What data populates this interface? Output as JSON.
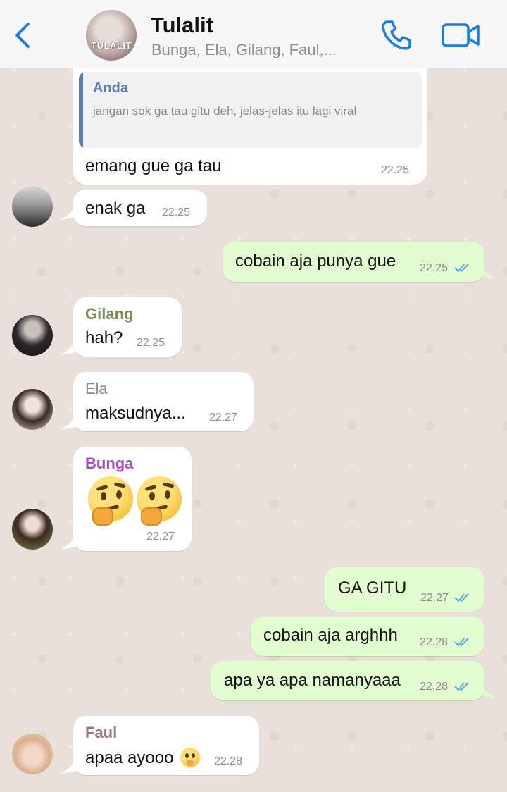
{
  "header": {
    "back_icon": "chevron-left-icon",
    "group_name": "Tulalit",
    "members": "Bunga, Ela, Gilang, Faul,...",
    "avatar_label": "TULALIT",
    "call_icon": "phone-icon",
    "video_icon": "video-camera-icon",
    "accent_color": "#1a7cf5"
  },
  "messages": {
    "m1": {
      "quote_author": "Anda",
      "quote_text": "jangan sok ga tau gitu deh, jelas-jelas itu lagi viral",
      "text": "emang gue ga tau",
      "time": "22.25"
    },
    "m2": {
      "text": "enak ga",
      "time": "22.25"
    },
    "m3": {
      "text": "cobain aja punya gue",
      "time": "22.25"
    },
    "m4": {
      "sender": "Gilang",
      "text": "hah?",
      "time": "22.25"
    },
    "m5": {
      "sender": "Ela",
      "text": "maksudnya...",
      "time": "22.27"
    },
    "m6": {
      "sender": "Bunga",
      "text": "🤔🤔",
      "time": "22.27"
    },
    "m7": {
      "text": "GA GITU",
      "time": "22.27"
    },
    "m8": {
      "text": "cobain aja arghhh",
      "time": "22.28"
    },
    "m9": {
      "text": "apa ya apa namanyaaa",
      "time": "22.28"
    },
    "m10": {
      "sender": "Faul",
      "text": "apaa ayooo",
      "time": "22.28"
    }
  },
  "colors": {
    "gilang": "#7a8f58",
    "ela": "#8a8a8a",
    "bunga": "#a64fbf",
    "faul": "#9a7d7d",
    "outgoing_bubble": "#e2fdd0",
    "read_ticks": "#5aa9e6"
  }
}
